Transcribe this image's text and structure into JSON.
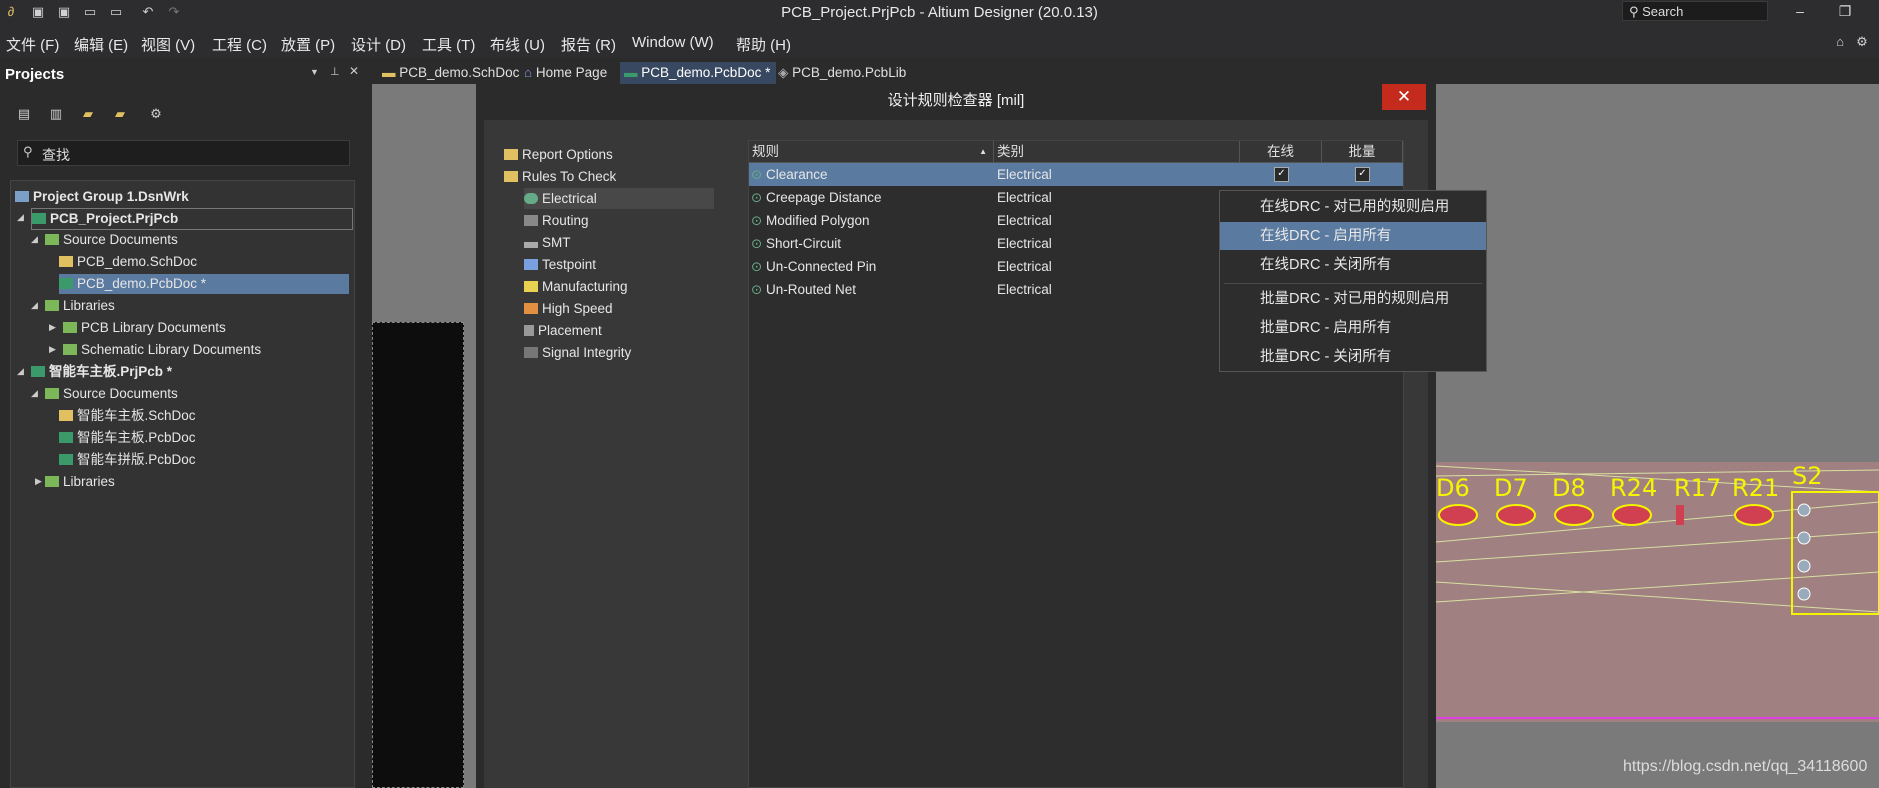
{
  "window": {
    "title": "PCB_Project.PrjPcb - Altium Designer (20.0.13)",
    "search_label": "Search"
  },
  "menu": [
    "文件 (F)",
    "编辑 (E)",
    "视图 (V)",
    "工程 (C)",
    "放置 (P)",
    "设计 (D)",
    "工具 (T)",
    "布线 (U)",
    "报告 (R)",
    "Window (W)",
    "帮助 (H)"
  ],
  "projects_panel": {
    "title": "Projects",
    "search_placeholder": "查找",
    "tree": [
      {
        "label": "Project Group 1.DsnWrk",
        "bold": true
      },
      {
        "label": "PCB_Project.PrjPcb",
        "bold": true
      },
      {
        "label": "Source Documents"
      },
      {
        "label": "PCB_demo.SchDoc"
      },
      {
        "label": "PCB_demo.PcbDoc *"
      },
      {
        "label": "Libraries"
      },
      {
        "label": "PCB Library Documents"
      },
      {
        "label": "Schematic Library Documents"
      },
      {
        "label": "智能车主板.PrjPcb *",
        "bold": true
      },
      {
        "label": "Source Documents"
      },
      {
        "label": "智能车主板.SchDoc"
      },
      {
        "label": "智能车主板.PcbDoc"
      },
      {
        "label": "智能车拼版.PcbDoc"
      },
      {
        "label": "Libraries"
      }
    ]
  },
  "tabs": [
    "PCB_demo.SchDoc",
    "Home Page",
    "PCB_demo.PcbDoc *",
    "PCB_demo.PcbLib"
  ],
  "dialog": {
    "title": "设计规则检查器 [mil]",
    "close_label": "✕",
    "left_tree": [
      "Report Options",
      "Rules To Check",
      "Electrical",
      "Routing",
      "SMT",
      "Testpoint",
      "Manufacturing",
      "High Speed",
      "Placement",
      "Signal Integrity"
    ],
    "columns": [
      "规则",
      "类别",
      "在线",
      "批量"
    ],
    "rules": [
      {
        "rule": "Clearance",
        "category": "Electrical",
        "online": true,
        "batch": true
      },
      {
        "rule": "Creepage Distance",
        "category": "Electrical"
      },
      {
        "rule": "Modified Polygon",
        "category": "Electrical"
      },
      {
        "rule": "Short-Circuit",
        "category": "Electrical"
      },
      {
        "rule": "Un-Connected Pin",
        "category": "Electrical"
      },
      {
        "rule": "Un-Routed Net",
        "category": "Electrical"
      }
    ]
  },
  "context_menu": [
    "在线DRC - 对已用的规则启用",
    "在线DRC - 启用所有",
    "在线DRC - 关闭所有",
    "批量DRC - 对已用的规则启用",
    "批量DRC - 启用所有",
    "批量DRC - 关闭所有"
  ],
  "pcb_labels": [
    "D6",
    "D7",
    "D8",
    "R24",
    "R17",
    "R21",
    "S2"
  ],
  "watermark": "https://blog.csdn.net/qq_34118600",
  "colors": {
    "selection": "#5a7aa0",
    "close_button": "#c42b1c",
    "pcb_silkscreen": "#f5f500",
    "pcb_board": "#a08080"
  }
}
